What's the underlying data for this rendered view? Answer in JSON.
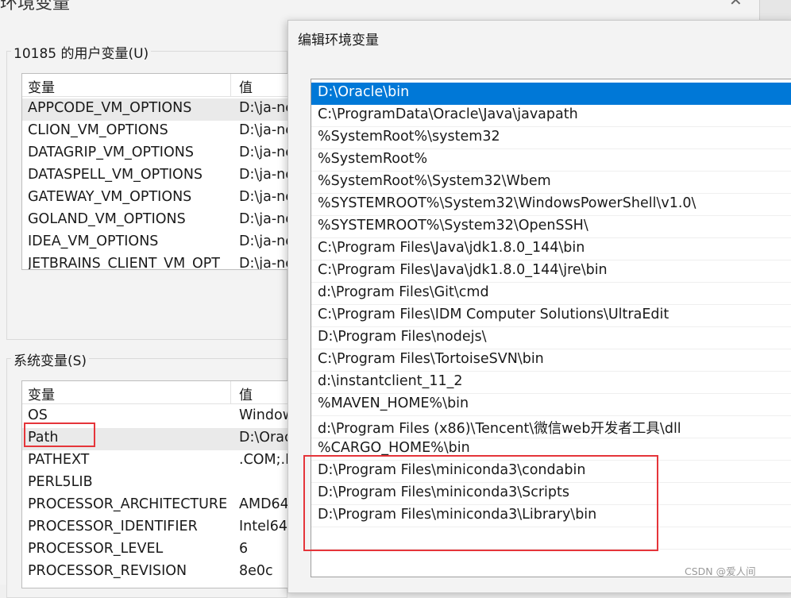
{
  "user_vars": {
    "group_label": "10185 的用户变量(U)",
    "col_name": "变量",
    "col_value": "值",
    "rows": [
      {
        "name": "APPCODE_VM_OPTIONS",
        "value": "D:\\ja-ne"
      },
      {
        "name": "CLION_VM_OPTIONS",
        "value": "D:\\ja-ne"
      },
      {
        "name": "DATAGRIP_VM_OPTIONS",
        "value": "D:\\ja-ne"
      },
      {
        "name": "DATASPELL_VM_OPTIONS",
        "value": "D:\\ja-ne"
      },
      {
        "name": "GATEWAY_VM_OPTIONS",
        "value": "D:\\ja-ne"
      },
      {
        "name": "GOLAND_VM_OPTIONS",
        "value": "D:\\ja-ne"
      },
      {
        "name": "IDEA_VM_OPTIONS",
        "value": "D:\\ja-ne"
      },
      {
        "name": "JETBRAINS_CLIENT_VM_OPT",
        "value": "D:\\ja-ne"
      }
    ]
  },
  "system_vars": {
    "group_label": "系统变量(S)",
    "col_name": "变量",
    "col_value": "值",
    "rows": [
      {
        "name": "OS",
        "value": "Window"
      },
      {
        "name": "Path",
        "value": "D:\\Orac"
      },
      {
        "name": "PATHEXT",
        "value": ".COM;.E"
      },
      {
        "name": "PERL5LIB",
        "value": ""
      },
      {
        "name": "PROCESSOR_ARCHITECTURE",
        "value": "AMD64"
      },
      {
        "name": "PROCESSOR_IDENTIFIER",
        "value": "Intel64"
      },
      {
        "name": "PROCESSOR_LEVEL",
        "value": "6"
      },
      {
        "name": "PROCESSOR_REVISION",
        "value": "8e0c"
      }
    ]
  },
  "edit_dialog": {
    "title": "编辑环境变量",
    "paths": [
      "D:\\Oracle\\bin",
      "C:\\ProgramData\\Oracle\\Java\\javapath",
      "%SystemRoot%\\system32",
      "%SystemRoot%",
      "%SystemRoot%\\System32\\Wbem",
      "%SYSTEMROOT%\\System32\\WindowsPowerShell\\v1.0\\",
      "%SYSTEMROOT%\\System32\\OpenSSH\\",
      "C:\\Program Files\\Java\\jdk1.8.0_144\\bin",
      "C:\\Program Files\\Java\\jdk1.8.0_144\\jre\\bin",
      "d:\\Program Files\\Git\\cmd",
      "C:\\Program Files\\IDM Computer Solutions\\UltraEdit",
      "D:\\Program Files\\nodejs\\",
      "C:\\Program Files\\TortoiseSVN\\bin",
      "d:\\instantclient_11_2",
      "%MAVEN_HOME%\\bin",
      "d:\\Program Files (x86)\\Tencent\\微信web开发者工具\\dll",
      "%CARGO_HOME%\\bin",
      "D:\\Program Files\\miniconda3\\condabin",
      "D:\\Program Files\\miniconda3\\Scripts",
      "D:\\Program Files\\miniconda3\\Library\\bin",
      ""
    ]
  },
  "watermark": "CSDN @爱人间"
}
